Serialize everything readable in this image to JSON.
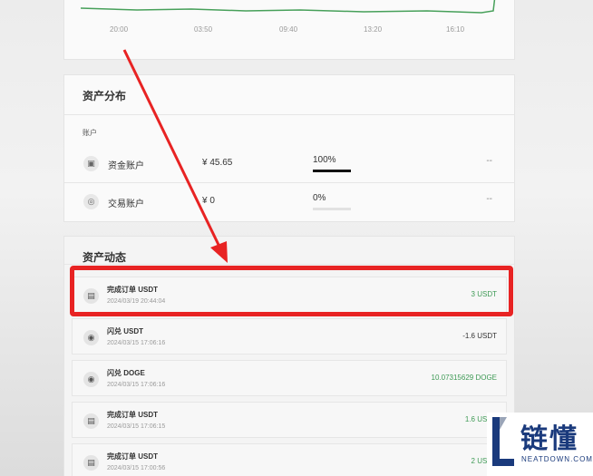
{
  "chart": {
    "x_ticks": [
      "20:00",
      "03:50",
      "09:40",
      "13:20",
      "16:10"
    ],
    "line_color": "#47a05a"
  },
  "distribution": {
    "title": "资产分布",
    "sub_label": "账户",
    "accounts": [
      {
        "name": "资金账户",
        "amount": "¥ 45.65",
        "percent": "100%",
        "share": 1.0,
        "trailing": "--"
      },
      {
        "name": "交易账户",
        "amount": "¥ 0",
        "percent": "0%",
        "share": 0.0,
        "trailing": "--"
      }
    ]
  },
  "activity": {
    "title": "资产动态",
    "items": [
      {
        "title": "完成订单 USDT",
        "date": "2024/03/19 20:44:04",
        "amount": "3 USDT",
        "positive": true
      },
      {
        "title": "闪兑 USDT",
        "date": "2024/03/15 17:06:16",
        "amount": "-1.6 USDT",
        "positive": false
      },
      {
        "title": "闪兑 DOGE",
        "date": "2024/03/15 17:06:16",
        "amount": "10.07315629 DOGE",
        "positive": true
      },
      {
        "title": "完成订单 USDT",
        "date": "2024/03/15 17:06:15",
        "amount": "1.6 USDT",
        "positive": true
      },
      {
        "title": "完成订单 USDT",
        "date": "2024/03/15 17:00:56",
        "amount": "2 USDT",
        "positive": true
      }
    ]
  },
  "watermark": {
    "cn": "链懂",
    "en": "NEATDOWN.COM"
  },
  "colors": {
    "highlight": "#e82323",
    "positive": "#3e9a55",
    "logo": "#1a3a7c"
  }
}
